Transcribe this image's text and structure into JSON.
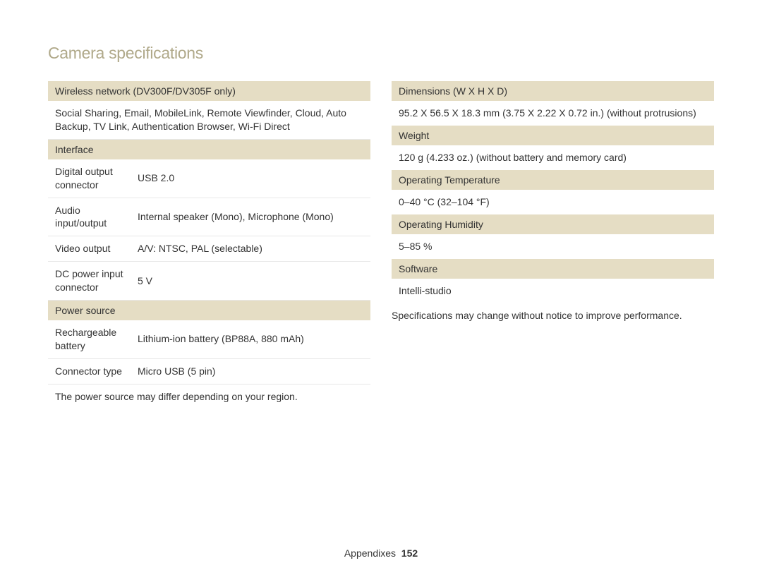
{
  "page_title": "Camera specifications",
  "left": {
    "wireless_header": "Wireless network (DV300F/DV305F only)",
    "wireless_body": "Social Sharing, Email, MobileLink, Remote Viewfinder, Cloud, Auto Backup, TV Link, Authentication Browser, Wi-Fi Direct",
    "interface_header": "Interface",
    "interface_rows": [
      {
        "label": "Digital output connector",
        "value": "USB 2.0"
      },
      {
        "label": "Audio input/output",
        "value": "Internal speaker (Mono), Microphone (Mono)"
      },
      {
        "label": "Video output",
        "value": "A/V: NTSC, PAL (selectable)"
      },
      {
        "label": "DC power input connector",
        "value": "5 V"
      }
    ],
    "power_header": "Power source",
    "power_rows": [
      {
        "label": "Rechargeable battery",
        "value": "Lithium-ion battery (BP88A, 880 mAh)"
      },
      {
        "label": "Connector type",
        "value": "Micro USB (5 pin)"
      }
    ],
    "power_note": "The power source may differ depending on your region."
  },
  "right": {
    "dimensions_header": "Dimensions (W X H X D)",
    "dimensions_value": "95.2 X 56.5 X 18.3 mm (3.75 X 2.22 X 0.72 in.) (without protrusions)",
    "weight_header": "Weight",
    "weight_value": "120 g (4.233 oz.) (without battery and memory card)",
    "optemp_header": "Operating Temperature",
    "optemp_value": "0–40 °C (32–104 °F)",
    "ophum_header": "Operating Humidity",
    "ophum_value": "5–85 %",
    "software_header": "Software",
    "software_value": "Intelli-studio",
    "disclaimer": "Specifications may change without notice to improve performance."
  },
  "footer": {
    "section": "Appendixes",
    "page": "152"
  }
}
